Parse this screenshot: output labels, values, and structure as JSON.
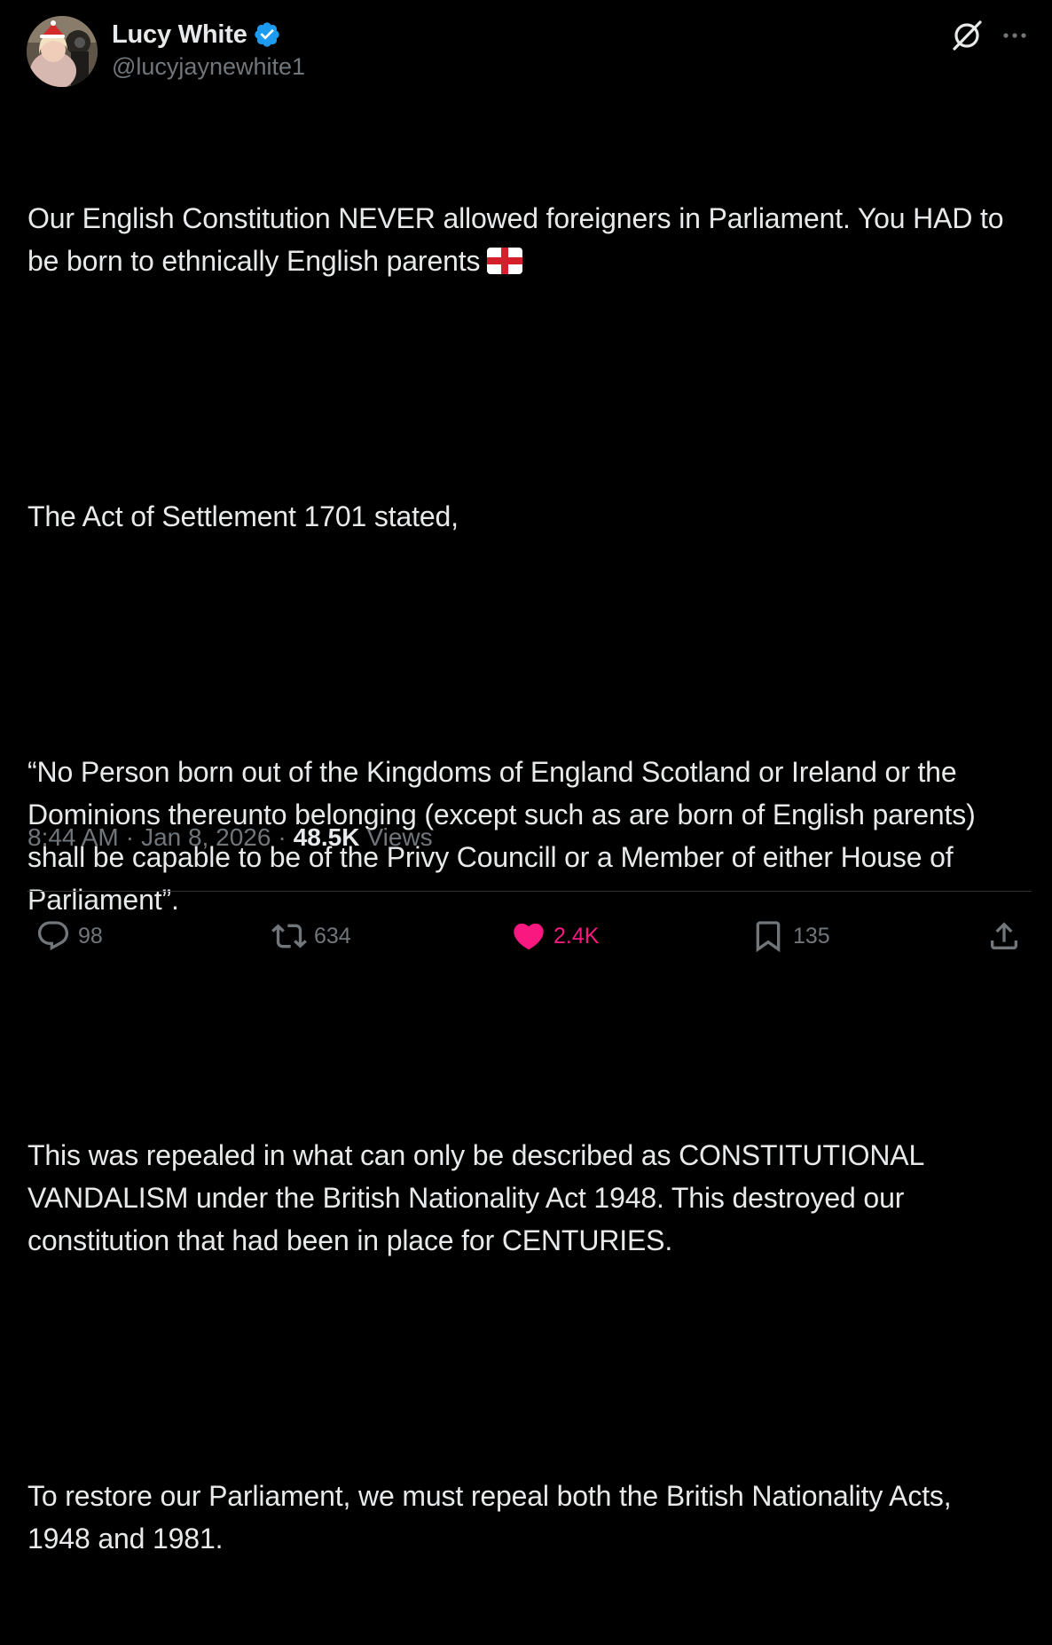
{
  "author": {
    "display_name": "Lucy White",
    "handle": "@lucyjaynewhite1",
    "verified": true,
    "verified_color": "#1d9bf0"
  },
  "tweet": {
    "paragraphs": [
      "Our English Constitution NEVER allowed foreigners in Parliament. You HAD to be born to ethnically English parents",
      "The Act of Settlement 1701 stated,",
      "“No Person born out of the Kingdoms of England Scotland or Ireland or the Dominions thereunto belonging (except such as are born of English parents) shall be capable to be of the Privy Councill or a Member of either House of Parliament”.",
      "This was repealed in what can only be described as CONSTITUTIONAL VANDALISM under the British Nationality Act 1948. This destroyed our constitution that had been in place for CENTURIES.",
      "To restore our Parliament, we must repeal both the British Nationality Acts, 1948 and 1981."
    ],
    "emoji": "england-flag-icon"
  },
  "meta": {
    "time": "8:44 AM",
    "separator": "·",
    "date": "Jan 8, 2026",
    "views_count": "48.5K",
    "views_label": "Views"
  },
  "actions": {
    "replies": "98",
    "reposts": "634",
    "likes": "2.4K",
    "bookmarks": "135"
  },
  "colors": {
    "background": "#000000",
    "text": "#e7e9ea",
    "secondary": "#71767b",
    "like_active": "#f91880",
    "divider": "#2f3336"
  }
}
